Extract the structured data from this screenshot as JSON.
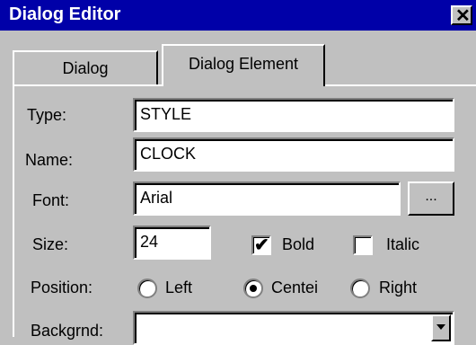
{
  "window": {
    "title": "Dialog Editor",
    "close_glyph": "✕"
  },
  "tabs": [
    {
      "label": "Dialog",
      "active": false
    },
    {
      "label": "Dialog Element",
      "active": true
    }
  ],
  "form": {
    "type_label": "Type:",
    "type_value": "STYLE",
    "name_label": "Name:",
    "name_value": "CLOCK",
    "font_label": "Font:",
    "font_value": "Arial",
    "font_browse": "...",
    "size_label": "Size:",
    "size_value": "24",
    "bold_label": "Bold",
    "bold_checked": true,
    "italic_label": "Italic",
    "italic_checked": false,
    "position_label": "Position:",
    "position_options": [
      "Left",
      "Center",
      "Right"
    ],
    "position_visible_labels": [
      "Left",
      "Centei",
      "Right"
    ],
    "position_selected": "Center",
    "background_label": "Backgrnd:",
    "background_value": ""
  },
  "colors": {
    "titlebar": "#0000a8",
    "face": "#c0c0c0"
  }
}
